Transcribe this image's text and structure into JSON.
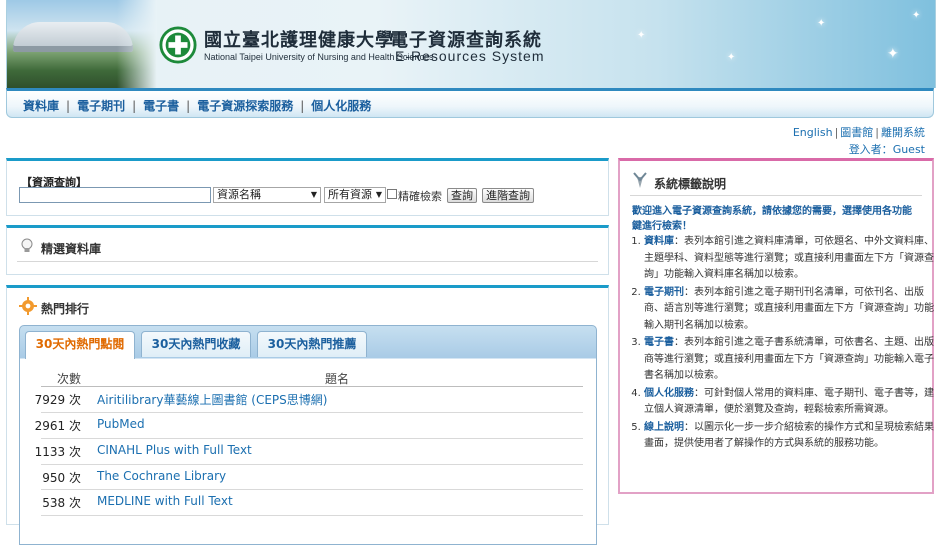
{
  "header": {
    "univ_cn": "國立臺北護理健康大學",
    "univ_en": "National Taipei University of Nursing and Health Sciences",
    "system_cn": "電子資源查詢系統",
    "system_en": "E-Resources System"
  },
  "nav": {
    "items": [
      "資料庫",
      "電子期刊",
      "電子書",
      "電子資源探索服務",
      "個人化服務"
    ],
    "separator": "|"
  },
  "top_links": {
    "english": "English",
    "library": "圖書館",
    "leave": "離開系統",
    "sep": "|",
    "login_label": "登入者：",
    "login_user": "Guest"
  },
  "search": {
    "title": "【資源查詢】",
    "input_value": "",
    "field_select": "資源名稱",
    "scope_select": "所有資源",
    "exact_label": "精確檢索",
    "search_button": "查詢",
    "advanced_button": "進階查詢"
  },
  "featured": {
    "title": "精選資料庫"
  },
  "hot": {
    "title": "熱門排行",
    "tabs": [
      "30天內熱門點閱",
      "30天內熱門收藏",
      "30天內熱門推薦"
    ],
    "columns": {
      "count": "次數",
      "name": "題名"
    },
    "unit": "次",
    "rows": [
      {
        "count": "7929",
        "name": "Airitilibrary華藝線上圖書館 (CEPS思博網)"
      },
      {
        "count": "2961",
        "name": "PubMed"
      },
      {
        "count": "1133",
        "name": "CINAHL Plus with Full Text"
      },
      {
        "count": "950",
        "name": "The Cochrane Library"
      },
      {
        "count": "538",
        "name": "MEDLINE with Full Text"
      }
    ]
  },
  "system_panel": {
    "title": "系統標籤說明",
    "welcome": "歡迎進入電子資源查詢系統，請依據您的需要，選擇使用各功能鍵進行檢索！",
    "items": [
      {
        "term": "資料庫",
        "desc": "：表列本館引進之資料庫清單，可依題名、中外文資料庫、主題學科、資料型態等進行瀏覽；或直接利用畫面左下方「資源查詢」功能輸入資料庫名稱加以檢索。"
      },
      {
        "term": "電子期刊",
        "desc": "：表列本館引進之電子期刊刊名清單，可依刊名、出版商、語言別等進行瀏覽；或直接利用畫面左下方「資源查詢」功能輸入期刊名稱加以檢索。"
      },
      {
        "term": "電子書",
        "desc": "：表列本館引進之電子書系統清單，可依書名、主題、出版商等進行瀏覽；或直接利用畫面左下方「資源查詢」功能輸入電子書名稱加以檢索。"
      },
      {
        "term": "個人化服務",
        "desc": "：可針對個人常用的資料庫、電子期刊、電子書等，建立個人資源清單，便於瀏覽及查詢，輕鬆檢索所需資源。"
      },
      {
        "term": "線上說明",
        "desc": "：以圖示化一步一步介紹檢索的操作方式和呈現檢索結果畫面，提供使用者了解操作的方式與系統的服務功能。"
      }
    ]
  },
  "colors": {
    "nav_link": "#1b5f9e",
    "hot_tab_active": "#e06a00",
    "panel_top_blue": "#1a9bc9",
    "panel_top_pink": "#d96aa8"
  }
}
